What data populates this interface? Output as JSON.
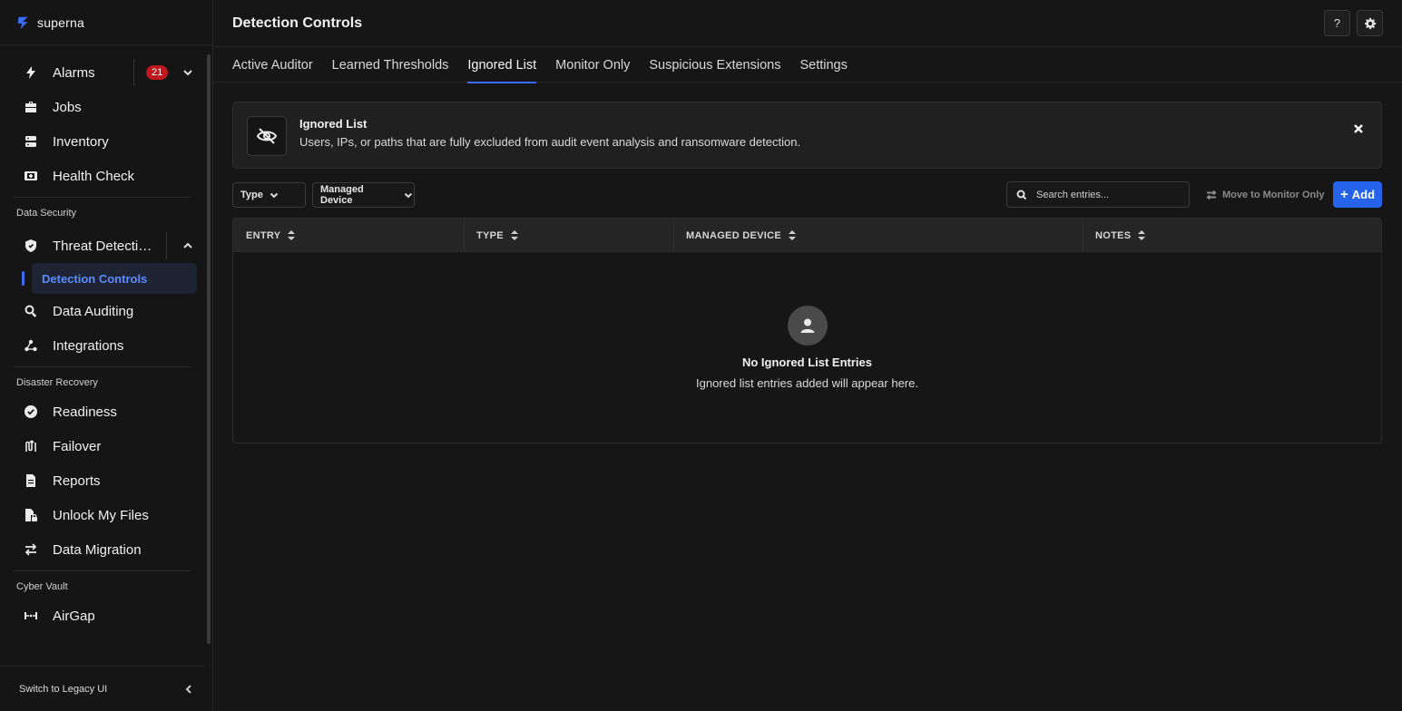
{
  "brand": {
    "name": "superna"
  },
  "sidebar": {
    "items_top": [
      {
        "label": "Alarms",
        "badge": "21"
      },
      {
        "label": "Jobs"
      },
      {
        "label": "Inventory"
      },
      {
        "label": "Health Check"
      }
    ],
    "sections": {
      "data_security": "Data Security",
      "disaster_recovery": "Disaster Recovery",
      "cyber_vault": "Cyber Vault"
    },
    "threat_detection": "Threat Detectio...",
    "detection_controls": "Detection Controls",
    "data_auditing": "Data Auditing",
    "integrations": "Integrations",
    "readiness": "Readiness",
    "failover": "Failover",
    "reports": "Reports",
    "unlock_my_files": "Unlock My Files",
    "data_migration": "Data Migration",
    "airgap": "AirGap",
    "legacy": "Switch to Legacy UI"
  },
  "header": {
    "title": "Detection Controls",
    "help": "?"
  },
  "tabs": [
    {
      "label": "Active Auditor"
    },
    {
      "label": "Learned Thresholds"
    },
    {
      "label": "Ignored List"
    },
    {
      "label": "Monitor Only"
    },
    {
      "label": "Suspicious Extensions"
    },
    {
      "label": "Settings"
    }
  ],
  "banner": {
    "title": "Ignored List",
    "description": "Users, IPs, or paths that are fully excluded from audit event analysis and ransomware detection."
  },
  "toolbar": {
    "type_filter": "Type",
    "device_filter": "Managed Device",
    "search_placeholder": "Search entries...",
    "move_label": "Move to Monitor Only",
    "add_label": "Add"
  },
  "table": {
    "columns": [
      "ENTRY",
      "TYPE",
      "MANAGED DEVICE",
      "NOTES"
    ],
    "empty_title": "No Ignored List Entries",
    "empty_subtitle": "Ignored list entries added will appear here."
  },
  "colors": {
    "accent": "#2563eb",
    "active_nav_text": "#5b8cff",
    "badge": "#c0181f"
  }
}
